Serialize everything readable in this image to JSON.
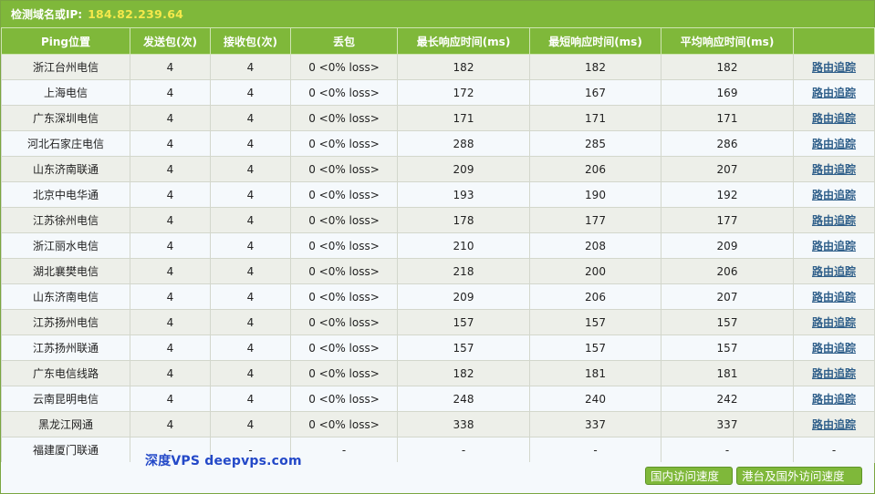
{
  "title": {
    "label": "检测域名或IP:",
    "ip": "184.82.239.64"
  },
  "columns": [
    "Ping位置",
    "发送包(次)",
    "接收包(次)",
    "丢包",
    "最长响应时间(ms)",
    "最短响应时间(ms)",
    "平均响应时间(ms)",
    ""
  ],
  "rows": [
    {
      "location": "浙江台州电信",
      "sent": "4",
      "recv": "4",
      "loss": "0 <0% loss>",
      "max": "182",
      "min": "182",
      "avg": "182",
      "trace": "路由追踪"
    },
    {
      "location": "上海电信",
      "sent": "4",
      "recv": "4",
      "loss": "0 <0% loss>",
      "max": "172",
      "min": "167",
      "avg": "169",
      "trace": "路由追踪"
    },
    {
      "location": "广东深圳电信",
      "sent": "4",
      "recv": "4",
      "loss": "0 <0% loss>",
      "max": "171",
      "min": "171",
      "avg": "171",
      "trace": "路由追踪"
    },
    {
      "location": "河北石家庄电信",
      "sent": "4",
      "recv": "4",
      "loss": "0 <0% loss>",
      "max": "288",
      "min": "285",
      "avg": "286",
      "trace": "路由追踪"
    },
    {
      "location": "山东济南联通",
      "sent": "4",
      "recv": "4",
      "loss": "0 <0% loss>",
      "max": "209",
      "min": "206",
      "avg": "207",
      "trace": "路由追踪"
    },
    {
      "location": "北京中电华通",
      "sent": "4",
      "recv": "4",
      "loss": "0 <0% loss>",
      "max": "193",
      "min": "190",
      "avg": "192",
      "trace": "路由追踪"
    },
    {
      "location": "江苏徐州电信",
      "sent": "4",
      "recv": "4",
      "loss": "0 <0% loss>",
      "max": "178",
      "min": "177",
      "avg": "177",
      "trace": "路由追踪"
    },
    {
      "location": "浙江丽水电信",
      "sent": "4",
      "recv": "4",
      "loss": "0 <0% loss>",
      "max": "210",
      "min": "208",
      "avg": "209",
      "trace": "路由追踪"
    },
    {
      "location": "湖北襄樊电信",
      "sent": "4",
      "recv": "4",
      "loss": "0 <0% loss>",
      "max": "218",
      "min": "200",
      "avg": "206",
      "trace": "路由追踪"
    },
    {
      "location": "山东济南电信",
      "sent": "4",
      "recv": "4",
      "loss": "0 <0% loss>",
      "max": "209",
      "min": "206",
      "avg": "207",
      "trace": "路由追踪"
    },
    {
      "location": "江苏扬州电信",
      "sent": "4",
      "recv": "4",
      "loss": "0 <0% loss>",
      "max": "157",
      "min": "157",
      "avg": "157",
      "trace": "路由追踪"
    },
    {
      "location": "江苏扬州联通",
      "sent": "4",
      "recv": "4",
      "loss": "0 <0% loss>",
      "max": "157",
      "min": "157",
      "avg": "157",
      "trace": "路由追踪"
    },
    {
      "location": "广东电信线路",
      "sent": "4",
      "recv": "4",
      "loss": "0 <0% loss>",
      "max": "182",
      "min": "181",
      "avg": "181",
      "trace": "路由追踪"
    },
    {
      "location": "云南昆明电信",
      "sent": "4",
      "recv": "4",
      "loss": "0 <0% loss>",
      "max": "248",
      "min": "240",
      "avg": "242",
      "trace": "路由追踪"
    },
    {
      "location": "黑龙江网通",
      "sent": "4",
      "recv": "4",
      "loss": "0 <0% loss>",
      "max": "338",
      "min": "337",
      "avg": "337",
      "trace": "路由追踪"
    },
    {
      "location": "福建厦门联通",
      "sent": "-",
      "recv": "-",
      "loss": "-",
      "max": "-",
      "min": "-",
      "avg": "-",
      "trace": "-"
    }
  ],
  "watermark": "深度VPS  deepvps.com",
  "buttons": {
    "domestic": "国内访问速度",
    "overseas": "港台及国外访问速度"
  },
  "colors": {
    "header_green": "#7fb83a",
    "ip_yellow": "#f5e84b",
    "link_blue": "#2f5f8a",
    "watermark_blue": "#2449c8"
  }
}
